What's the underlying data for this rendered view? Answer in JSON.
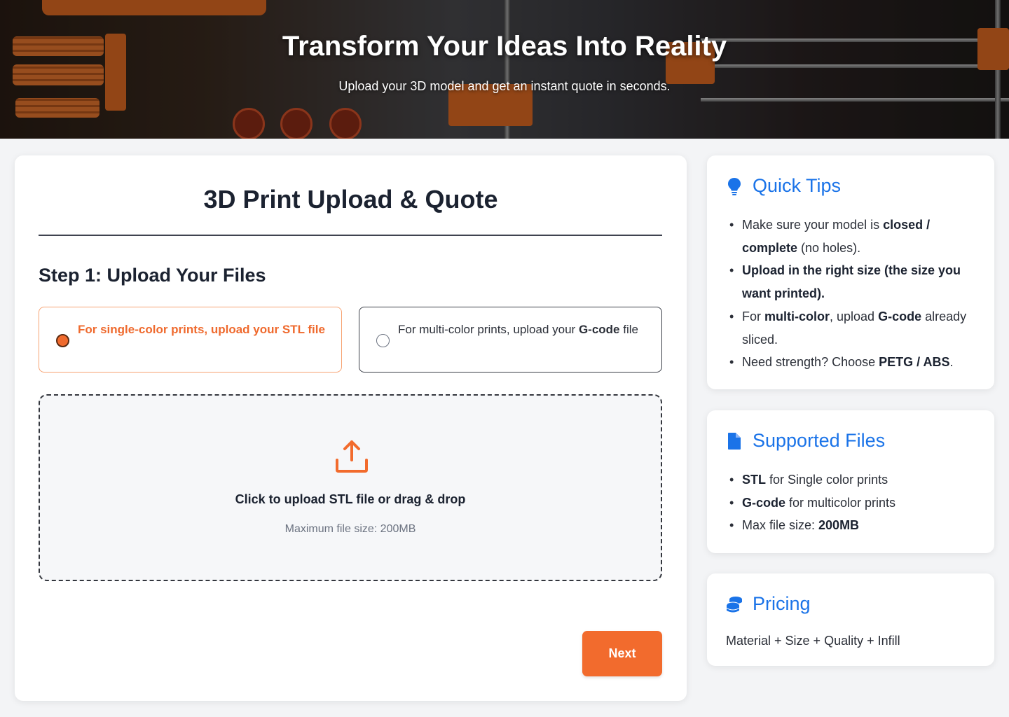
{
  "hero": {
    "title": "Transform Your Ideas Into Reality",
    "subtitle": "Upload your 3D model and get an instant quote in seconds."
  },
  "main": {
    "title": "3D Print Upload & Quote",
    "step_title": "Step 1: Upload Your Files",
    "options": [
      {
        "pre": "For single-color prints, upload your STL file",
        "selected": true
      },
      {
        "pre": "For multi-color prints, upload your ",
        "bold": "G-code",
        "post": " file",
        "selected": false
      }
    ],
    "dropzone": {
      "title": "Click to upload STL file or drag & drop",
      "subtitle": "Maximum file size: 200MB"
    },
    "next_label": "Next"
  },
  "tips": {
    "title": "Quick Tips",
    "icon": "lightbulb-icon",
    "items": [
      {
        "a": "Make sure your model is ",
        "b": "closed / complete",
        "c": " (no holes)."
      },
      {
        "a": "",
        "b": "Upload in the right size (the size you want printed).",
        "c": ""
      },
      {
        "a": "For ",
        "b": "multi-color",
        "c": ", upload ",
        "d": "G-code",
        "e": " already sliced."
      },
      {
        "a": "Need strength? Choose ",
        "b": "PETG / ABS",
        "c": "."
      }
    ]
  },
  "files": {
    "title": "Supported Files",
    "icon": "file-icon",
    "items": [
      {
        "b": "STL",
        "c": " for Single color prints"
      },
      {
        "b": "G-code",
        "c": " for multicolor prints"
      },
      {
        "a": "Max file size: ",
        "b": "200MB"
      }
    ]
  },
  "pricing": {
    "title": "Pricing",
    "icon": "coins-icon",
    "formula": "Material + Size + Quality + Infill"
  },
  "colors": {
    "accent": "#f26b2d",
    "link_blue": "#1a73e8"
  }
}
